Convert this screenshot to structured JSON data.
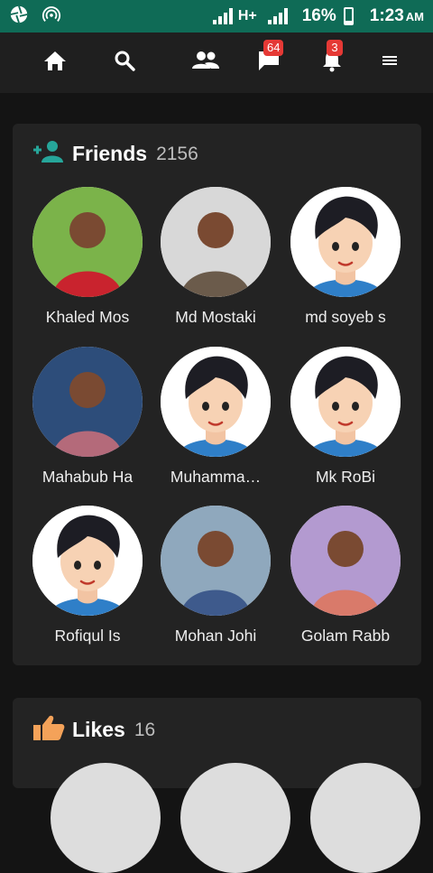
{
  "status": {
    "network": "H+",
    "battery": "16%",
    "time": "1:23",
    "ampm": "AM"
  },
  "nav": {
    "icons": [
      "home-icon",
      "search-icon",
      "friends-icon",
      "messages-icon",
      "notifications-icon",
      "menu-icon"
    ],
    "messages_badge": "64",
    "notifications_badge": "3"
  },
  "friends": {
    "title": "Friends",
    "count": "2156",
    "items": [
      {
        "name": "Khaled Mos",
        "photo": "photo"
      },
      {
        "name": "Md Mostaki",
        "photo": "photo"
      },
      {
        "name": "md soyeb s",
        "photo": "avatar"
      },
      {
        "name": "Mahabub Ha",
        "photo": "photo"
      },
      {
        "name": "Muhamma…",
        "photo": "avatar"
      },
      {
        "name": "Mk RoBi",
        "photo": "avatar"
      },
      {
        "name": "Rofiqul Is",
        "photo": "avatar"
      },
      {
        "name": "Mohan Johi",
        "photo": "photo"
      },
      {
        "name": "Golam Rabb",
        "photo": "photo"
      }
    ]
  },
  "likes": {
    "title": "Likes",
    "count": "16"
  },
  "colors": {
    "status_bar": "#0f6b56",
    "accent_teal": "#26a69a",
    "badge_red": "#e53935",
    "like_orange": "#f4a259"
  }
}
